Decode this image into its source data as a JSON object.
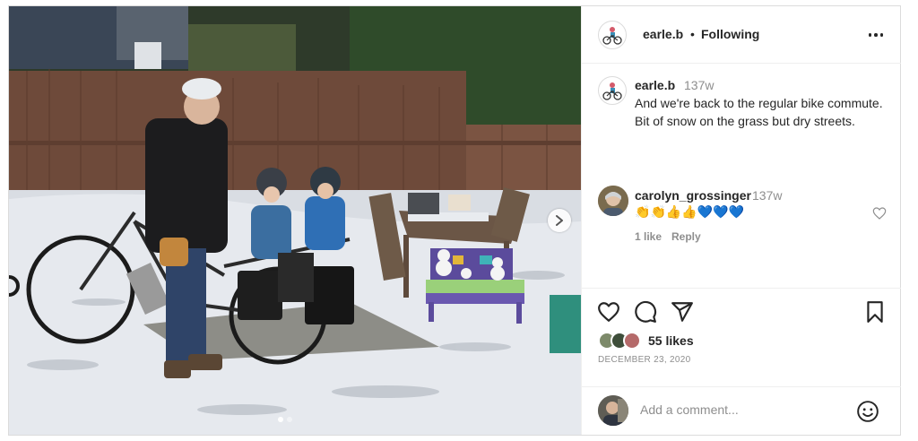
{
  "post": {
    "author": {
      "username": "earle.b",
      "follow_status": "Following",
      "separator": "•"
    },
    "caption": {
      "username": "earle.b",
      "time": "137w",
      "text": "And we're back to the regular bike commute. Bit of snow on the grass but dry streets."
    },
    "comments": [
      {
        "username": "carolyn_grossinger",
        "time": "137w",
        "emojis": [
          "👏",
          "👏",
          "👍",
          "👍",
          "💙",
          "💙",
          "💙"
        ],
        "likes_label": "1 like",
        "reply_label": "Reply"
      }
    ],
    "likes_label": "55 likes",
    "date": "DECEMBER 23, 2020",
    "add_comment_placeholder": "Add a comment...",
    "carousel": {
      "slides": 2,
      "active_index": 0
    }
  },
  "icons": {
    "more": "more-options-icon",
    "like": "heart-outline-icon",
    "comment": "comment-bubble-icon",
    "share": "paper-plane-icon",
    "save": "bookmark-icon",
    "emoji": "smiley-icon",
    "next": "chevron-right-icon",
    "avatar": "bicycle-avatar-icon"
  },
  "colors": {
    "text": "#262626",
    "secondary": "#8e8e8e",
    "border": "#dbdbdb",
    "blue_heart": "#1877f2"
  }
}
